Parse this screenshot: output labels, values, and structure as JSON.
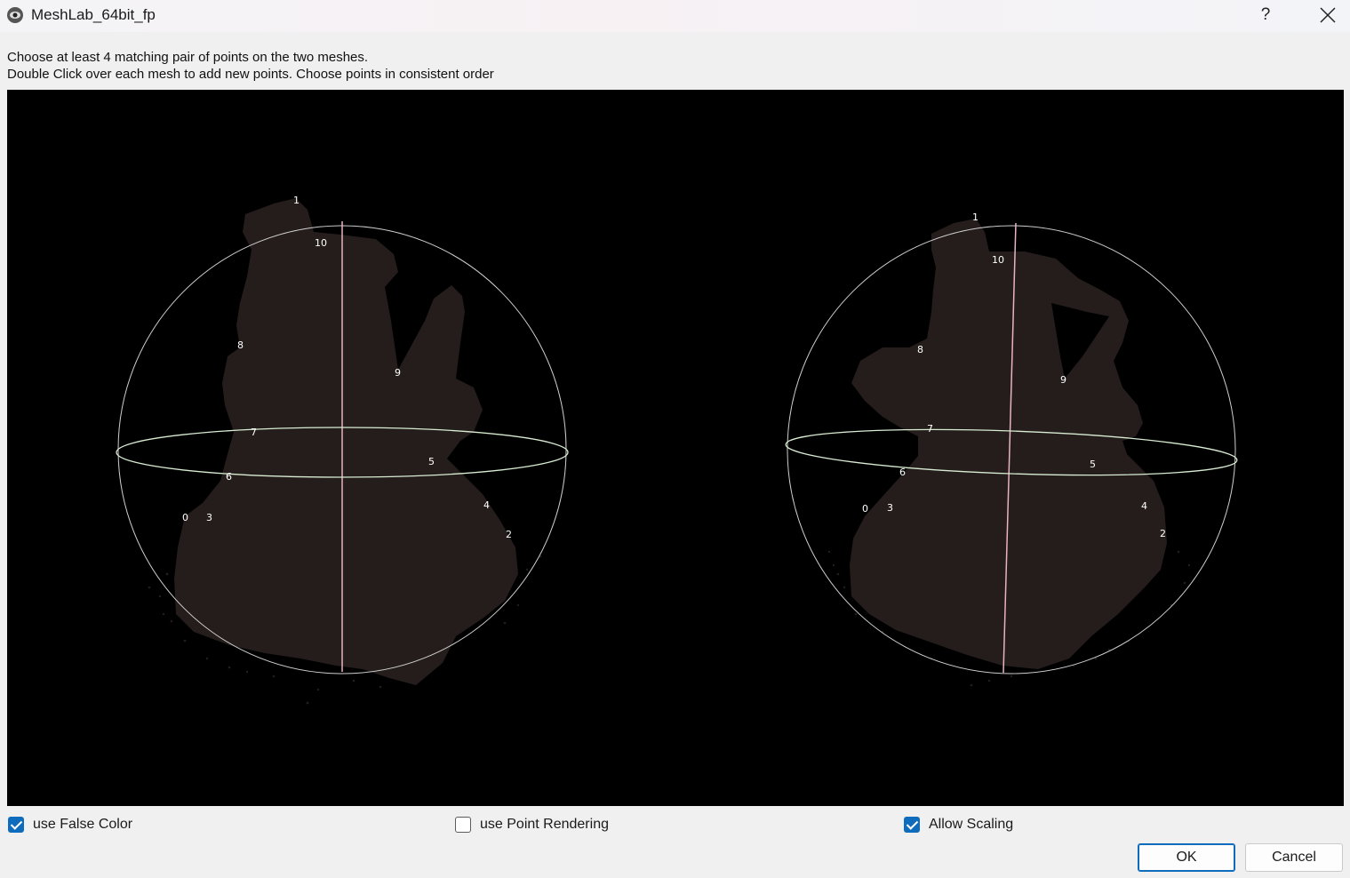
{
  "window": {
    "title": "MeshLab_64bit_fp",
    "help_label": "?",
    "close_icon": "close-icon"
  },
  "instructions": {
    "line1": "Choose at least 4 matching pair of points on the two meshes.",
    "line2": "Double Click over each mesh to add new points. Choose points in consistent order"
  },
  "viewport": {
    "left_mesh_points": [
      "1",
      "10",
      "8",
      "9",
      "7",
      "5",
      "6",
      "0",
      "3",
      "4",
      "2"
    ],
    "right_mesh_points": [
      "1",
      "10",
      "8",
      "9",
      "7",
      "5",
      "6",
      "0",
      "3",
      "4",
      "2"
    ]
  },
  "options": {
    "false_color": {
      "label": "use False Color",
      "checked": true
    },
    "point_rendering": {
      "label": "use Point Rendering",
      "checked": false
    },
    "allow_scaling": {
      "label": "Allow Scaling",
      "checked": true
    }
  },
  "buttons": {
    "ok": "OK",
    "cancel": "Cancel"
  },
  "colors": {
    "accent": "#0f6cbd",
    "mesh": "#241d1c",
    "viewport_bg": "#000000"
  }
}
